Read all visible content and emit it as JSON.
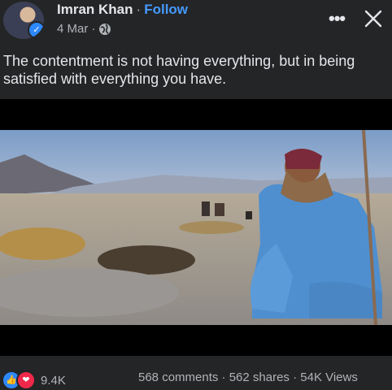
{
  "post": {
    "author": "Imran Khan",
    "separator": "·",
    "follow_label": "Follow",
    "date": "4 Mar",
    "meta_separator": "·",
    "privacy_icon": "globe-icon",
    "more_icon": "more-dots-icon",
    "more_glyph": "•••",
    "close_icon": "close-icon",
    "caption": "The contentment is not having everything, but in being satisfied with everything you have.",
    "verified_icon": "verified-badge-icon",
    "verified_glyph": "✓"
  },
  "footer": {
    "reaction_icons": [
      "like-icon",
      "love-icon"
    ],
    "like_glyph": "👍",
    "love_glyph": "❤",
    "reaction_count": "9.4K",
    "stats": "568 comments · 562 shares · 54K Views"
  },
  "colors": {
    "background": "#242526",
    "link": "#4599ff",
    "text": "#e4e6eb",
    "muted": "#b0b3b8"
  }
}
